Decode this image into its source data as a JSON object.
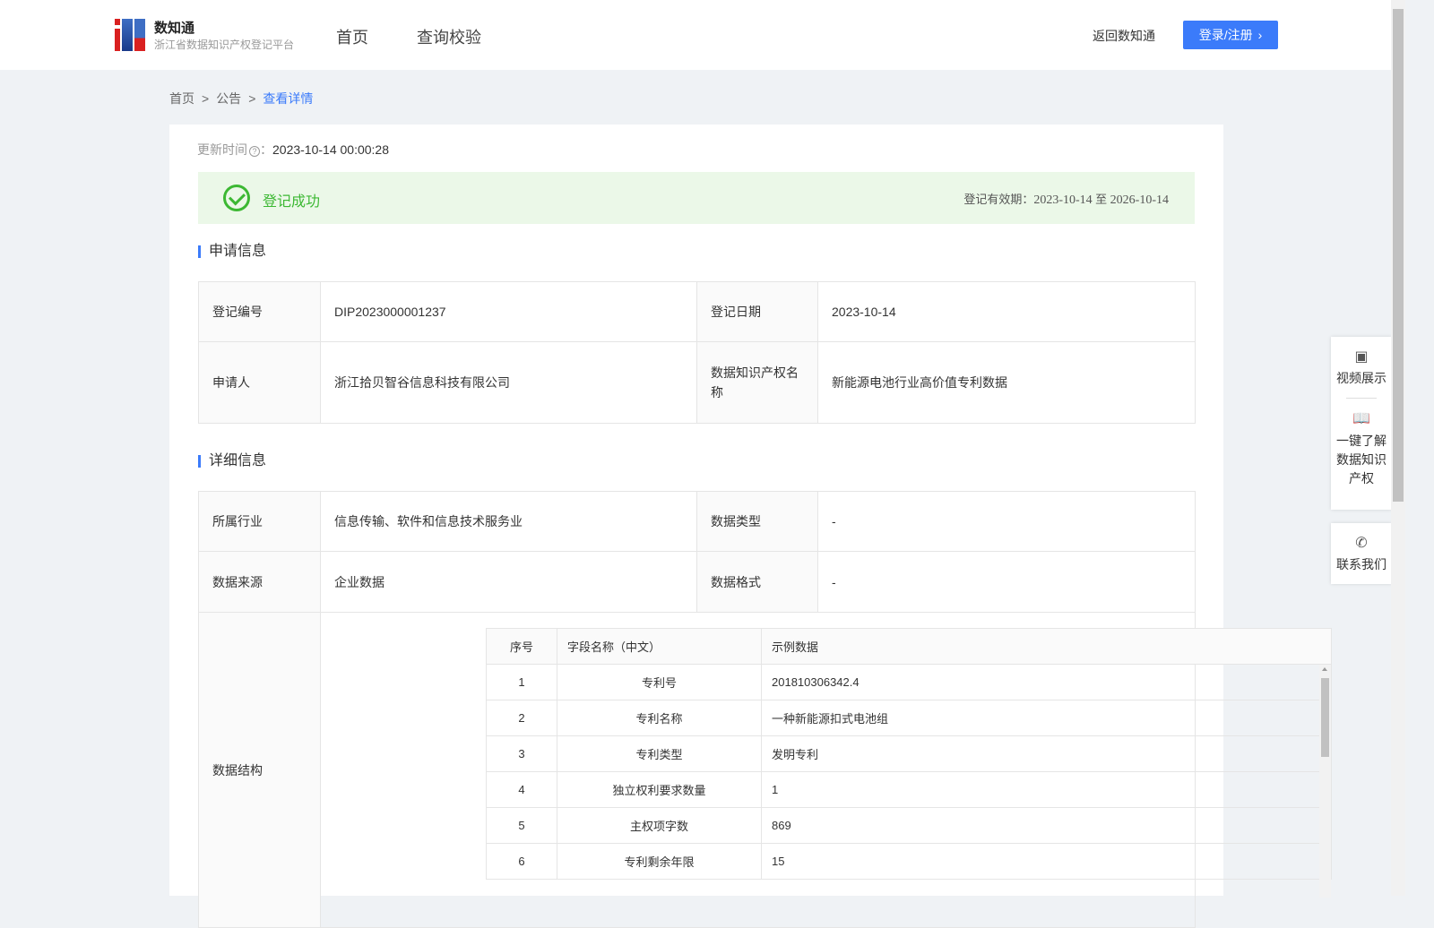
{
  "header": {
    "brand_name": "数知通",
    "brand_sub": "浙江省数据知识产权登记平台",
    "nav": [
      "首页",
      "查询校验"
    ],
    "back": "返回数知通",
    "login": "登录/注册"
  },
  "breadcrumb": [
    "首页",
    "公告",
    "查看详情"
  ],
  "update": {
    "label": "更新时间",
    "value": "2023-10-14 00:00:28"
  },
  "status": {
    "text": "登记成功",
    "valid_label": "登记有效期：",
    "valid_from": "2023-10-14",
    "valid_to_word": "至",
    "valid_to": "2026-10-14"
  },
  "apply": {
    "title": "申请信息",
    "rows": [
      {
        "k1": "登记编号",
        "v1": "DIP2023000001237",
        "k2": "登记日期",
        "v2": "2023-10-14"
      },
      {
        "k1": "申请人",
        "v1": "浙江拾贝智谷信息科技有限公司",
        "k2": "数据知识产权名称",
        "v2": "新能源电池行业高价值专利数据"
      }
    ]
  },
  "detail": {
    "title": "详细信息",
    "rows": [
      {
        "k1": "所属行业",
        "v1": "信息传输、软件和信息技术服务业",
        "k2": "数据类型",
        "v2": "-"
      },
      {
        "k1": "数据来源",
        "v1": "企业数据",
        "k2": "数据格式",
        "v2": "-"
      }
    ],
    "structure_label": "数据结构",
    "columns": [
      "序号",
      "字段名称（中文）",
      "示例数据"
    ],
    "fields": [
      [
        "1",
        "专利号",
        "201810306342.4"
      ],
      [
        "2",
        "专利名称",
        "一种新能源扣式电池组"
      ],
      [
        "3",
        "专利类型",
        "发明专利"
      ],
      [
        "4",
        "独立权利要求数量",
        "1"
      ],
      [
        "5",
        "主权项字数",
        "869"
      ],
      [
        "6",
        "专利剩余年限",
        "15"
      ]
    ]
  },
  "side": {
    "video": "视频展示",
    "learn": [
      "一键了解",
      "数据知识",
      "产权"
    ],
    "contact": "联系我们"
  }
}
